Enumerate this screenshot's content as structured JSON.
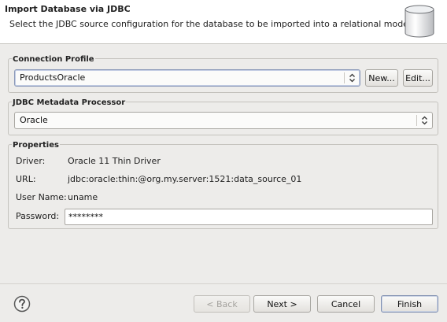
{
  "header": {
    "title": "Import Database via JDBC",
    "description": "Select the JDBC source configuration for the database to be imported into a relational model.",
    "icon": "database-icon"
  },
  "connection_profile": {
    "group_title": "Connection Profile",
    "selected": "ProductsOracle",
    "new_label": "New...",
    "edit_label": "Edit..."
  },
  "metadata_processor": {
    "group_title": "JDBC Metadata Processor",
    "selected": "Oracle"
  },
  "properties": {
    "group_title": "Properties",
    "driver_label": "Driver:",
    "driver_value": "Oracle 11 Thin Driver",
    "url_label": "URL:",
    "url_value": "jdbc:oracle:thin:@org.my.server:1521:data_source_01",
    "username_label": "User Name:",
    "username_value": "uname",
    "password_label": "Password:",
    "password_value": "********"
  },
  "footer": {
    "help_icon": "help-icon",
    "back_label": "< Back",
    "next_label": "Next >",
    "cancel_label": "Cancel",
    "finish_label": "Finish"
  },
  "colors": {
    "background": "#edecea",
    "banner": "#ffffff",
    "default_button_border": "#7f8fb0"
  }
}
